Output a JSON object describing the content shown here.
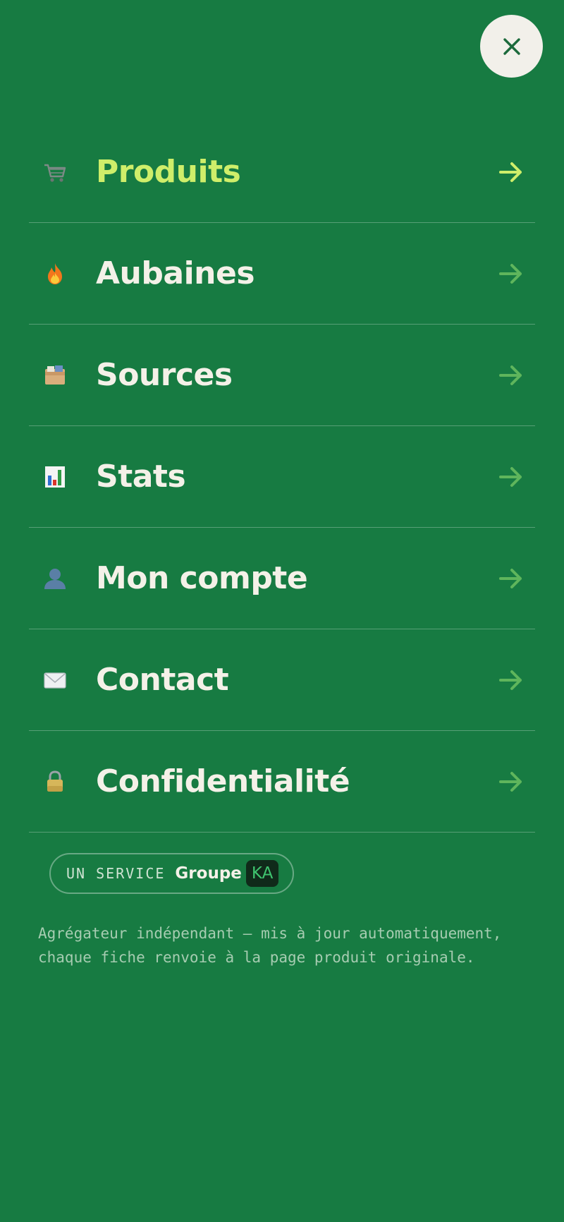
{
  "close_button": {
    "icon": "close-icon"
  },
  "menu": {
    "items": [
      {
        "emoji": "shopping-cart-icon",
        "label": "Produits",
        "active": true
      },
      {
        "emoji": "fire-icon",
        "label": "Aubaines",
        "active": false
      },
      {
        "emoji": "card-file-box-icon",
        "label": "Sources",
        "active": false
      },
      {
        "emoji": "bar-chart-icon",
        "label": "Stats",
        "active": false
      },
      {
        "emoji": "user-silhouette-icon",
        "label": "Mon compte",
        "active": false
      },
      {
        "emoji": "envelope-icon",
        "label": "Contact",
        "active": false
      },
      {
        "emoji": "lock-icon",
        "label": "Confidentialité",
        "active": false
      }
    ]
  },
  "service_badge": {
    "prefix": "UN SERVICE",
    "brand_word": "Groupe",
    "brand_mark": "KA"
  },
  "description": "Agrégateur indépendant — mis à jour automatiquement, chaque fiche renvoie à la page produit originale.",
  "colors": {
    "background": "#177b42",
    "active_label": "#cfee6a",
    "label": "#f4f1e8",
    "active_arrow": "#cfee6a",
    "arrow": "#5fb55c",
    "close_bg": "#f2f0ea",
    "close_icon": "#1c6a3c"
  }
}
